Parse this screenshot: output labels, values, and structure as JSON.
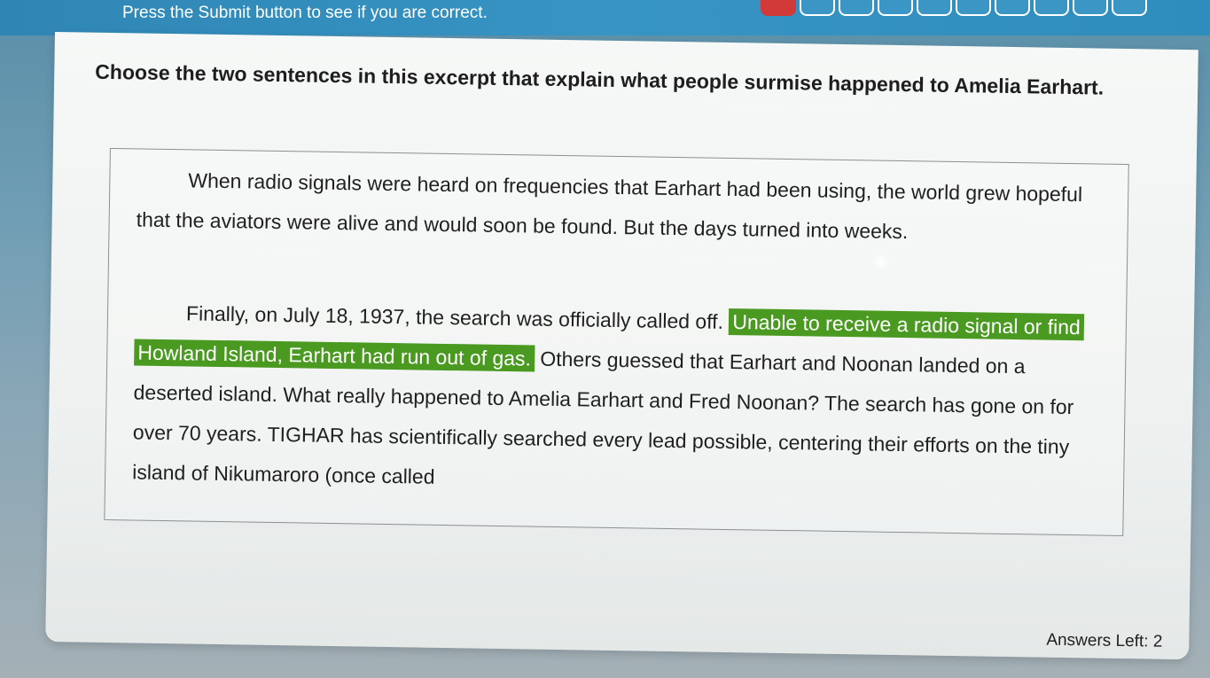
{
  "header": {
    "instruction": "Press the Submit button to see if you are correct.",
    "progress_total": 10,
    "progress_current": 1,
    "progress_accent": "#d23a3a"
  },
  "question": {
    "prompt": "Choose the two sentences in this excerpt that explain what people surmise happened to Amelia Earhart."
  },
  "passage": {
    "paragraphs": [
      [
        {
          "text": "When radio signals were heard on frequencies that Earhart had been using, the world grew hopeful that the aviators were alive and would soon be found.",
          "selected": false
        },
        {
          "text": "But the days turned into weeks.",
          "selected": false
        }
      ],
      [
        {
          "text": "Finally, on July 18, 1937, the search was officially called off.",
          "selected": false
        },
        {
          "text": "Unable to receive a radio signal or find Howland Island, Earhart had run out of gas.",
          "selected": true
        },
        {
          "text": "Others guessed that Earhart and Noonan landed on a deserted island.",
          "selected": false
        },
        {
          "text": "What really happened to Amelia Earhart and Fred Noonan?",
          "selected": false
        },
        {
          "text": "The search has gone on for over 70 years.",
          "selected": false
        },
        {
          "text": "TIGHAR has scientifically searched every lead possible, centering their efforts on the tiny island of Nikumaroro (once called",
          "selected": false
        }
      ]
    ],
    "highlight_color": "#4a9a21"
  },
  "footer": {
    "answers_left": "Answers Left: 2"
  }
}
